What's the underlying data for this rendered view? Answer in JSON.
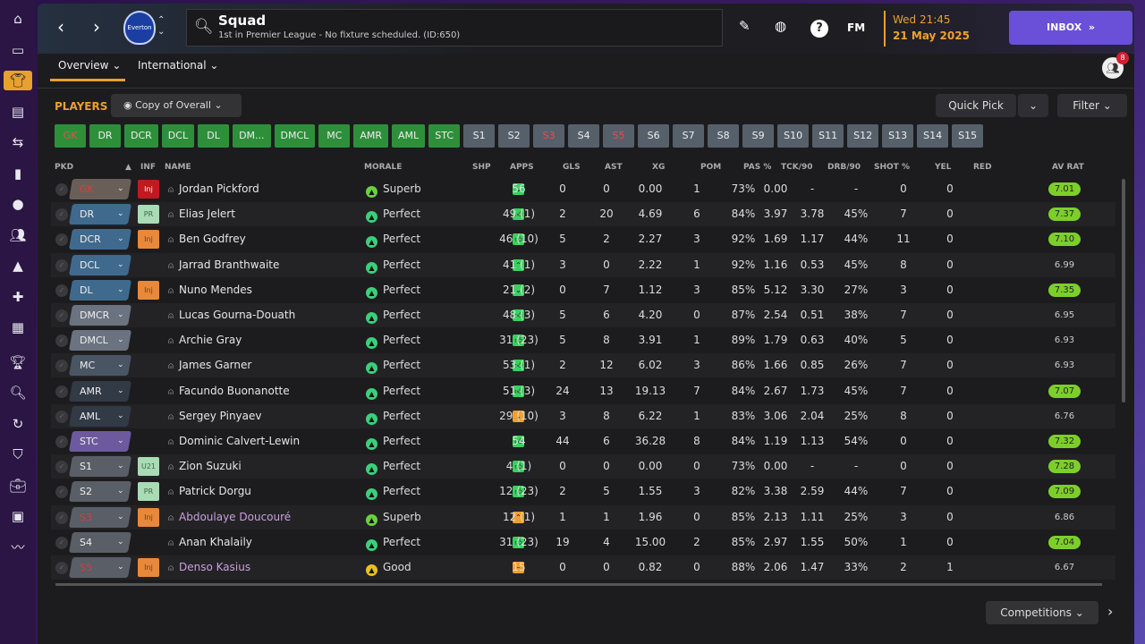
{
  "sidebar": {
    "icons": [
      "home-icon",
      "inbox-icon",
      "squad-icon",
      "tactics-icon",
      "dynamics-icon",
      "reports-icon",
      "data-hub-icon",
      "staff-icon",
      "training-icon",
      "medical-icon",
      "schedule-icon",
      "competitions-icon",
      "scouting-icon",
      "transfers-icon",
      "club-info-icon",
      "finances-icon",
      "dev-centre-icon",
      "trends-icon"
    ]
  },
  "header": {
    "title": "Squad",
    "subtitle": "1st in Premier League - No fixture scheduled. (ID:650)",
    "club": "Everton",
    "fm": "FM",
    "day_time": "Wed 21:45",
    "date": "21 May 2025",
    "inbox": "INBOX",
    "notif_count": "8"
  },
  "tabs": [
    "Overview",
    "International"
  ],
  "toolbar": {
    "players": "PLAYERS",
    "view": "Copy of Overall",
    "quick_pick": "Quick Pick",
    "filter": "Filter"
  },
  "chips": [
    {
      "l": "GK",
      "t": "g",
      "red": true
    },
    {
      "l": "DR",
      "t": "g"
    },
    {
      "l": "DCR",
      "t": "g"
    },
    {
      "l": "DCL",
      "t": "g"
    },
    {
      "l": "DL",
      "t": "g"
    },
    {
      "l": "DM...",
      "t": "g"
    },
    {
      "l": "DMCL",
      "t": "g"
    },
    {
      "l": "MC",
      "t": "g"
    },
    {
      "l": "AMR",
      "t": "g"
    },
    {
      "l": "AML",
      "t": "g"
    },
    {
      "l": "STC",
      "t": "g"
    },
    {
      "l": "S1",
      "t": "s"
    },
    {
      "l": "S2",
      "t": "s"
    },
    {
      "l": "S3",
      "t": "s",
      "red": true
    },
    {
      "l": "S4",
      "t": "s"
    },
    {
      "l": "S5",
      "t": "s",
      "red": true
    },
    {
      "l": "S6",
      "t": "s"
    },
    {
      "l": "S7",
      "t": "s"
    },
    {
      "l": "S8",
      "t": "s"
    },
    {
      "l": "S9",
      "t": "s"
    },
    {
      "l": "S10",
      "t": "s"
    },
    {
      "l": "S11",
      "t": "s"
    },
    {
      "l": "S12",
      "t": "s"
    },
    {
      "l": "S13",
      "t": "s"
    },
    {
      "l": "S14",
      "t": "s"
    },
    {
      "l": "S15",
      "t": "s"
    }
  ],
  "columns": [
    "PKD",
    "INF",
    "NAME",
    "MORALE",
    "SHP",
    "APPS",
    "GLS",
    "AST",
    "XG",
    "POM",
    "PAS %",
    "TCK/90",
    "DRB/90",
    "SHOT %",
    "YEL",
    "RED",
    "AV RAT"
  ],
  "colors": {
    "accent": "#e8a030",
    "inbox": "#6a4fd8",
    "green_chip": "#2e8f3a",
    "rating_green": "#7ccf2a"
  },
  "players": [
    [
      "GK",
      "Inj:red",
      "Jordan Pickford",
      "Superb",
      "down",
      "56",
      "0",
      "0",
      "0.00",
      "1",
      "73%",
      "0.00",
      "-",
      "-",
      "0",
      "0",
      "7.01"
    ],
    [
      "DR",
      "PR",
      "Elias Jelert",
      "Perfect",
      "thumb",
      "49 (1)",
      "2",
      "20",
      "4.69",
      "6",
      "84%",
      "3.97",
      "3.78",
      "45%",
      "7",
      "0",
      "7.37"
    ],
    [
      "DCR",
      "Inj:orange",
      "Ben Godfrey",
      "Perfect",
      "thumb",
      "46 (10)",
      "5",
      "2",
      "2.27",
      "3",
      "92%",
      "1.69",
      "1.17",
      "44%",
      "11",
      "0",
      "7.10"
    ],
    [
      "DCL",
      "",
      "Jarrad Branthwaite",
      "Perfect",
      "up",
      "41 (1)",
      "3",
      "0",
      "2.22",
      "1",
      "92%",
      "1.16",
      "0.53",
      "45%",
      "8",
      "0",
      "6.99"
    ],
    [
      "DL",
      "Inj:orange",
      "Nuno Mendes",
      "Perfect",
      "down",
      "21 (2)",
      "0",
      "7",
      "1.12",
      "3",
      "85%",
      "5.12",
      "3.30",
      "27%",
      "3",
      "0",
      "7.35"
    ],
    [
      "DMCR",
      "",
      "Lucas Gourna-Douath",
      "Perfect",
      "thumb",
      "48 (3)",
      "5",
      "6",
      "4.20",
      "0",
      "87%",
      "2.54",
      "0.51",
      "38%",
      "7",
      "0",
      "6.95"
    ],
    [
      "DMCL",
      "",
      "Archie Gray",
      "Perfect",
      "thumb",
      "31 (23)",
      "5",
      "8",
      "3.91",
      "1",
      "89%",
      "1.79",
      "0.63",
      "40%",
      "5",
      "0",
      "6.93"
    ],
    [
      "MC",
      "",
      "James Garner",
      "Perfect",
      "thumb",
      "53 (1)",
      "2",
      "12",
      "6.02",
      "3",
      "86%",
      "1.66",
      "0.85",
      "26%",
      "7",
      "0",
      "6.93"
    ],
    [
      "AMR",
      "",
      "Facundo Buonanotte",
      "Perfect",
      "thumb",
      "51 (3)",
      "24",
      "13",
      "19.13",
      "7",
      "84%",
      "2.67",
      "1.73",
      "45%",
      "7",
      "0",
      "7.07"
    ],
    [
      "AML",
      "",
      "Sergey Pinyaev",
      "Perfect",
      "down-orange",
      "29 (10)",
      "3",
      "8",
      "6.22",
      "1",
      "83%",
      "3.06",
      "2.04",
      "25%",
      "8",
      "0",
      "6.76"
    ],
    [
      "STC",
      "",
      "Dominic Calvert-Lewin",
      "Perfect",
      "thumb",
      "54",
      "44",
      "6",
      "36.28",
      "8",
      "84%",
      "1.19",
      "1.13",
      "54%",
      "0",
      "0",
      "7.32"
    ],
    [
      "S1",
      "U21",
      "Zion Suzuki",
      "Perfect",
      "thumb",
      "4 (1)",
      "0",
      "0",
      "0.00",
      "0",
      "73%",
      "0.00",
      "-",
      "-",
      "0",
      "0",
      "7.28"
    ],
    [
      "S2",
      "PR",
      "Patrick Dorgu",
      "Perfect",
      "thumb",
      "12 (23)",
      "2",
      "5",
      "1.55",
      "3",
      "82%",
      "3.38",
      "2.59",
      "44%",
      "7",
      "0",
      "7.09"
    ],
    [
      "S3",
      "Inj:orange",
      "Abdoulaye Doucouré",
      "Superb",
      "up-orange",
      "12 (1)",
      "1",
      "1",
      "1.96",
      "0",
      "85%",
      "2.13",
      "1.11",
      "25%",
      "3",
      "0",
      "6.86"
    ],
    [
      "S4",
      "",
      "Anan Khalaily",
      "Perfect",
      "thumb",
      "31 (23)",
      "19",
      "4",
      "15.00",
      "2",
      "85%",
      "2.97",
      "1.55",
      "50%",
      "1",
      "0",
      "7.04"
    ],
    [
      "S5",
      "Inj:orange",
      "Denso Kasius",
      "Good",
      "dash-orange",
      "15",
      "0",
      "0",
      "0.82",
      "0",
      "88%",
      "2.06",
      "1.47",
      "33%",
      "2",
      "1",
      "6.67"
    ]
  ],
  "footer": {
    "competitions": "Competitions"
  }
}
